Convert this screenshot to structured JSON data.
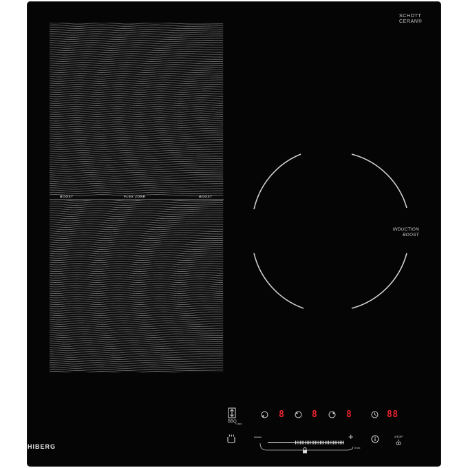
{
  "brand": {
    "logo": "HIBERG",
    "glass_brand_line1": "SCHOTT",
    "glass_brand_line2": "CERAN®"
  },
  "flex_zone": {
    "left_boost": "BOOST",
    "center_label": "FLEX ZONE",
    "right_boost": "BOOST"
  },
  "induction_zone": {
    "label_line1": "INDUCTION",
    "label_line2": "BOOST"
  },
  "controls": {
    "bbq_label": "BBQ",
    "bbq_time": "3 sec",
    "zone_displays": [
      "8",
      "8",
      "8"
    ],
    "timer_display": "88",
    "lock_time": "3 sec",
    "stop_label": "STOP",
    "minus_symbol": "—",
    "plus_symbol": "+"
  },
  "colors": {
    "glass": "#050505",
    "display_red": "#e8242c",
    "marking_white": "#d9d9d9"
  },
  "icons": [
    "bbq-icon",
    "pan-icon",
    "zone-select-icon",
    "timer-icon",
    "lock-icon",
    "info-icon",
    "stop-go-icon",
    "minus-icon",
    "plus-icon"
  ]
}
